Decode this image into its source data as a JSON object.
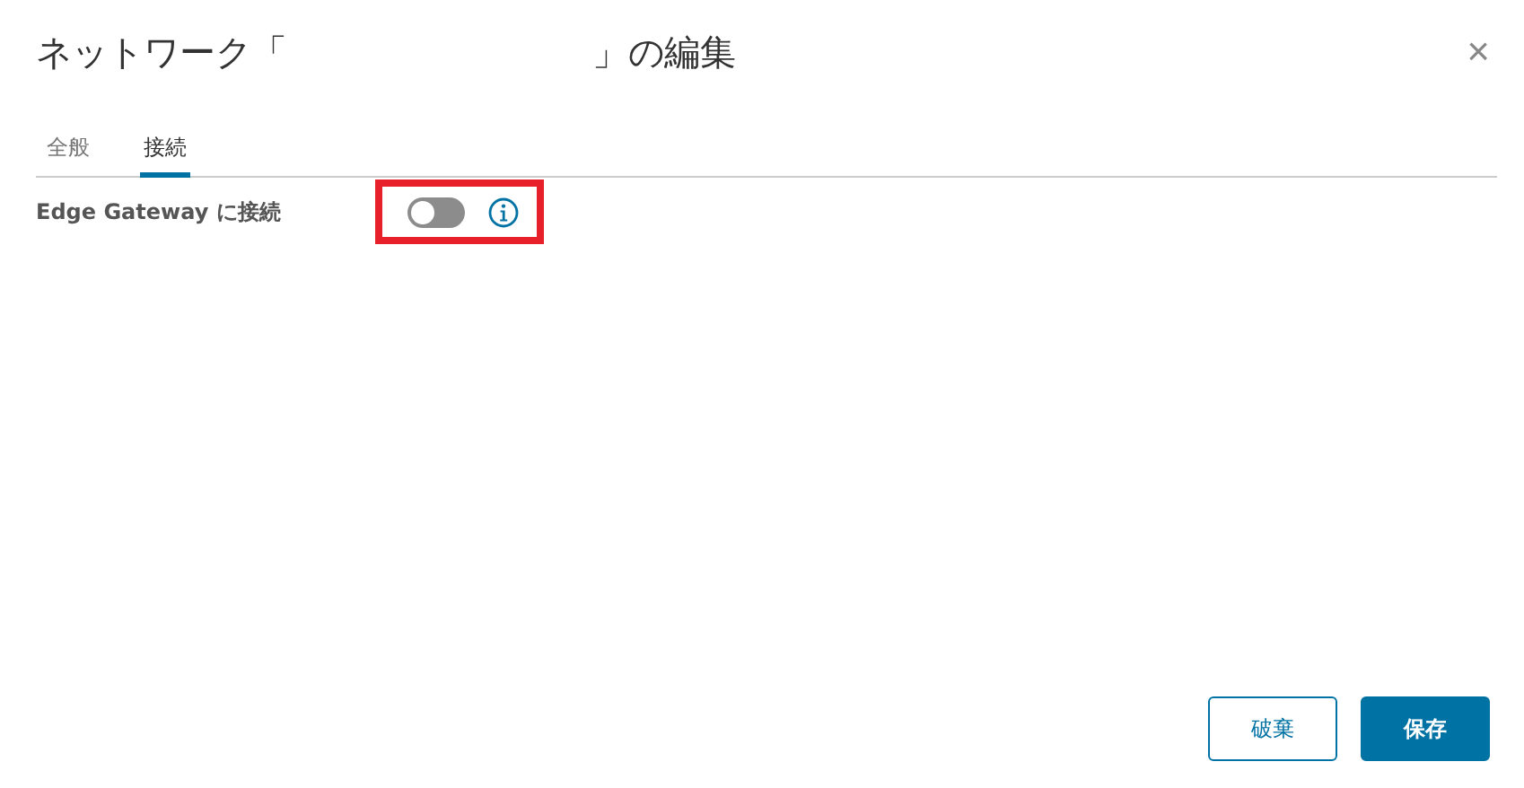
{
  "dialog": {
    "title_start": "ネットワーク「",
    "title_end": "」の編集",
    "close": "×"
  },
  "tabs": [
    {
      "label": "全般",
      "selected": false
    },
    {
      "label": "接続",
      "selected": true
    }
  ],
  "fields": [
    {
      "kind": "toggle",
      "label": "Edge Gateway に接続",
      "on": false,
      "info": true,
      "highlighted": true
    }
  ],
  "buttons": [
    {
      "label": "破棄",
      "kind": "secondary"
    },
    {
      "label": "保存",
      "kind": "primary"
    }
  ]
}
